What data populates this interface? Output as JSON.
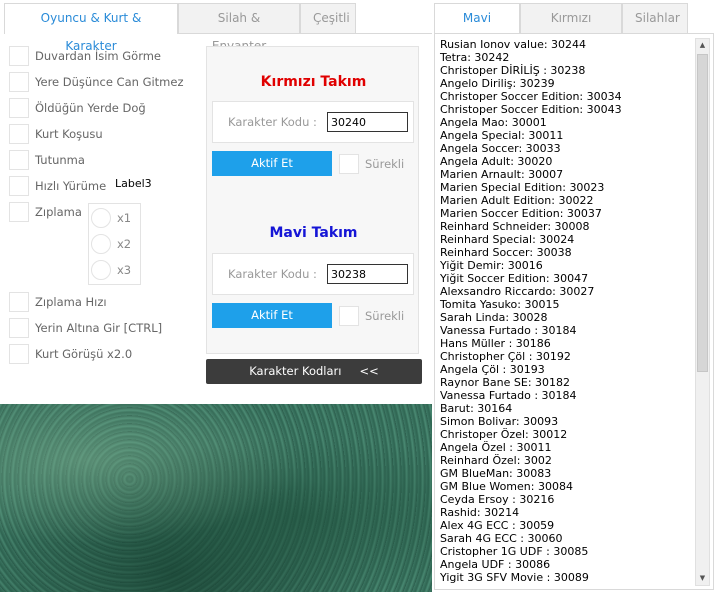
{
  "left_tabs": [
    "Oyuncu & Kurt & Karakter",
    "Silah & Envanter",
    "Çeşitli"
  ],
  "right_tabs": [
    "Mavi Takım",
    "Kırmızı Takım",
    "Silahlar"
  ],
  "checkboxes": [
    "Duvardan İsim Görme",
    "Yere Düşünce Can Gitmez",
    "Öldüğün Yerde Doğ",
    "Kurt Koşusu",
    "Tutunma",
    "Hızlı Yürüme",
    "Zıplama",
    "Zıplama Hızı",
    "Yerin Altına Gir [CTRL]",
    "Kurt Görüşü x2.0"
  ],
  "label3": "Label3",
  "jump_options": [
    "x1",
    "x2",
    "x3"
  ],
  "red_team": {
    "title": "Kırmızı Takım",
    "title_color": "#e00000",
    "code_label": "Karakter Kodu :",
    "code_value": "30240",
    "activate_label": "Aktif Et",
    "continuous_label": "Sürekli"
  },
  "blue_team": {
    "title": "Mavi Takım",
    "title_color": "#1515d6",
    "code_label": "Karakter Kodu :",
    "code_value": "30238",
    "activate_label": "Aktif Et",
    "continuous_label": "Sürekli"
  },
  "codes_button": {
    "label": "Karakter Kodları",
    "arrows": "<<"
  },
  "character_list": [
    "Rusian Ionov value: 30244",
    "Tetra: 30242",
    "Christoper DİRİLİŞ : 30238",
    "Angelo Diriliş: 30239",
    "Christoper Soccer Edition: 30034",
    "Christoper Soccer Edition: 30043",
    "Angela Mao: 30001",
    "Angela Special: 30011",
    "Angela Soccer: 30033",
    "Angela Adult: 30020",
    "Marien Arnault: 30007",
    "Marien Special Edition: 30023",
    "Marien Adult Edition: 30022",
    "Marien Soccer Edition: 30037",
    "Reinhard Schneider: 30008",
    "Reinhard Special: 30024",
    "Reinhard Soccer: 30038",
    "Yiğit Demir: 30016",
    "Yiğit Soccer Edition: 30047",
    "Alexsandro Riccardo: 30027",
    "Tomita Yasuko: 30015",
    "Sarah Linda: 30028",
    "Vanessa Furtado : 30184",
    "Hans Müller : 30186",
    "Christopher Çöl : 30192",
    "Angela Çöl : 30193",
    "Raynor Bane SE: 30182",
    "Vanessa Furtado : 30184",
    "Barut: 30164",
    "Simon Bolivar: 30093",
    "Christoper Özel: 30012",
    "Angela Özel : 30011",
    "Reinhard Özel: 3002",
    "GM BlueMan: 30083",
    "GM Blue Women: 30084",
    "Ceyda Ersoy : 30216",
    "Rashid: 30214",
    "Alex 4G ECC : 30059",
    "Sarah 4G ECC : 30060",
    "Cristopher 1G UDF : 30085",
    "Angela UDF : 30086",
    "Yigit 3G SFV Movie : 30089"
  ],
  "accent_color": "#1ea0ea"
}
